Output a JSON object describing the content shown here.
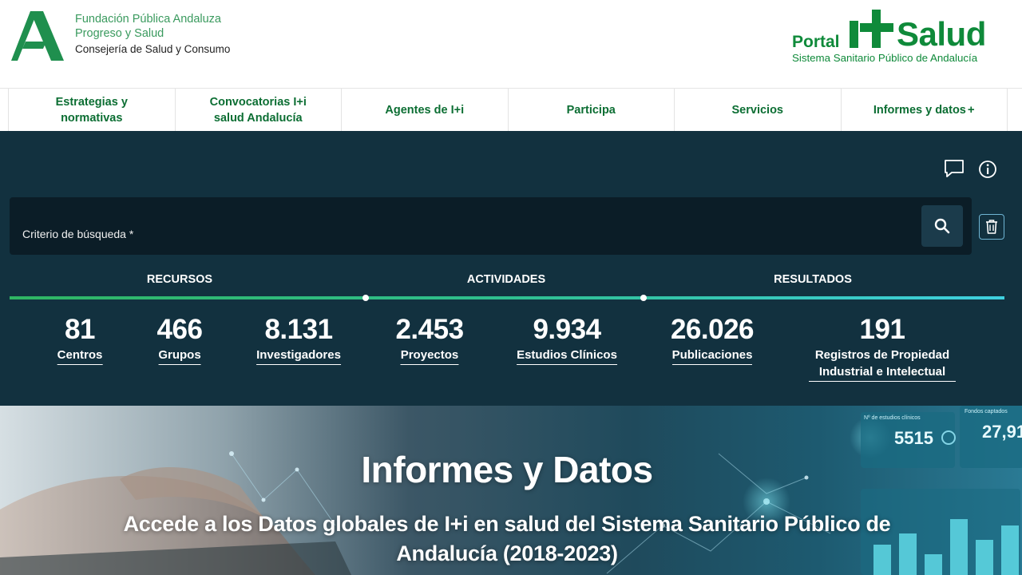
{
  "header": {
    "org_line1": "Fundación Pública Andaluza",
    "org_line2": "Progreso y Salud",
    "org_line3": "Consejería de Salud y Consumo",
    "portal_word": "Portal",
    "salud_word": "Salud",
    "portal_subtitle": "Sistema Sanitario Público de Andalucía"
  },
  "nav": {
    "items": [
      {
        "label": "Estrategias y normativas"
      },
      {
        "label": "Convocatorias I+i salud Andalucía"
      },
      {
        "label": "Agentes de I+i"
      },
      {
        "label": "Participa"
      },
      {
        "label": "Servicios"
      },
      {
        "label": "Informes y datos",
        "suffix": "+"
      }
    ]
  },
  "search": {
    "label": "Criterio de búsqueda *"
  },
  "sections": {
    "recursos": "RECURSOS",
    "actividades": "ACTIVIDADES",
    "resultados": "RESULTADOS"
  },
  "stats": [
    {
      "value": "81",
      "label": "Centros"
    },
    {
      "value": "466",
      "label": "Grupos"
    },
    {
      "value": "8.131",
      "label": "Investigadores"
    },
    {
      "value": "2.453",
      "label": "Proyectos"
    },
    {
      "value": "9.934",
      "label": "Estudios Clínicos"
    },
    {
      "value": "26.026",
      "label": "Publicaciones"
    },
    {
      "value": "191",
      "label": "Registros de Propiedad Industrial e Intelectual"
    }
  ],
  "hero": {
    "title": "Informes y Datos",
    "subtitle": "Accede a los Datos globales de I+i en salud del Sistema Sanitario Público de Andalucía (2018-2023)",
    "panel_label_1": "Nº de estudios clínicos",
    "panel_value_1": "5515",
    "panel_label_2": "Fondos captados",
    "panel_value_2": "27,91"
  },
  "colors": {
    "brand_green": "#0f8a3a",
    "dark_panel": "#12313f",
    "search_bg": "#0b1d27",
    "accent_cyan": "#3fd0e0"
  },
  "icons": {
    "chat": "chat-bubble-icon",
    "info": "info-icon",
    "search": "search-icon",
    "trash": "trash-icon"
  }
}
